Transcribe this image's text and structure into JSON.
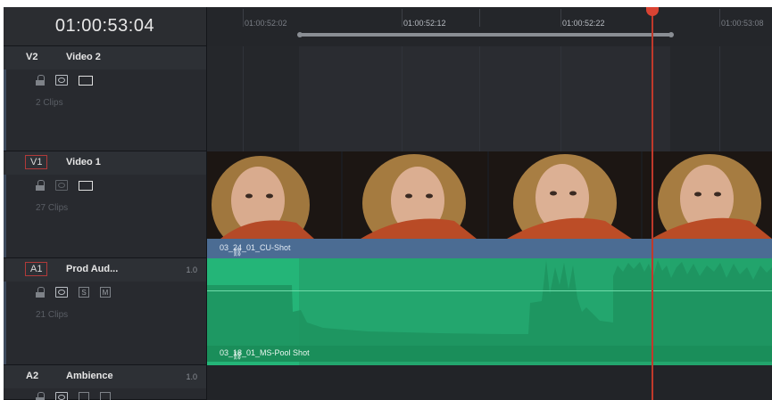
{
  "timecode": "01:00:53:04",
  "ruler": {
    "ticks": [
      "01:00:52:02",
      "01:00:52:12",
      "01:00:52:22",
      "01:00:53:08"
    ]
  },
  "tracks": {
    "v2": {
      "tag": "V2",
      "name": "Video 2",
      "clips": "2 Clips"
    },
    "v1": {
      "tag": "V1",
      "name": "Video 1",
      "clips": "27 Clips",
      "clip_name": "03_24_01_CU-Shot"
    },
    "a1": {
      "tag": "A1",
      "name": "Prod Aud...",
      "level": "1.0",
      "clips": "21 Clips",
      "clip_name": "03_18_01_MS-Pool Shot",
      "btn_s": "S",
      "btn_m": "M"
    },
    "a2": {
      "tag": "A2",
      "name": "Ambience",
      "level": "1.0"
    }
  },
  "colors": {
    "playhead": "#c0392b",
    "video_clip": "#4b6c93",
    "audio_clip": "#23a66e"
  },
  "icons": [
    "lock-icon",
    "auto-select-icon",
    "track-enable-icon",
    "solo-icon",
    "mute-icon",
    "link-icon"
  ]
}
